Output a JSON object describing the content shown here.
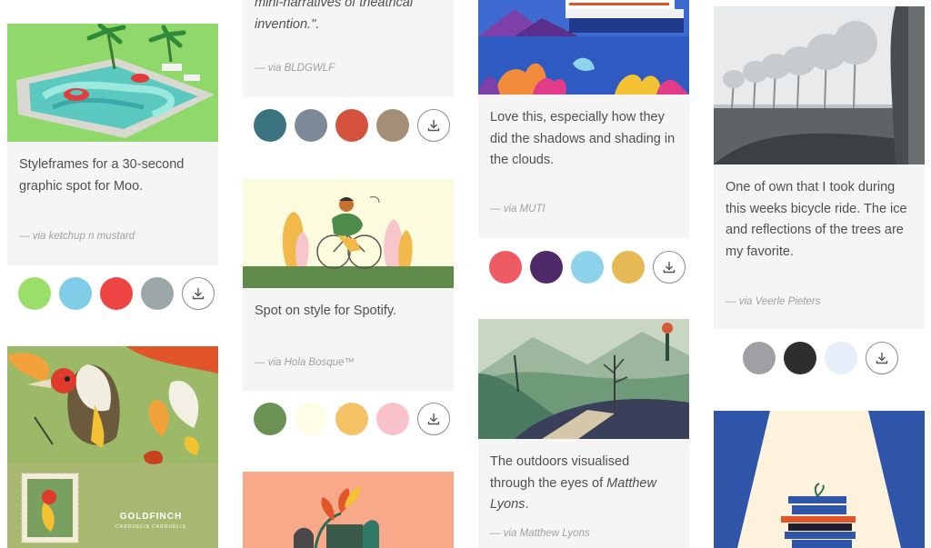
{
  "cards": [
    {
      "desc": "Styleframes for a 30-second graphic spot for Moo.",
      "via": "— via ketchup n mustard",
      "palette": [
        "#9bdf6b",
        "#7fcde6",
        "#ef4444",
        "#9ca7a8"
      ]
    },
    {
      "desc": "mini-narratives of theatrical invention.\".",
      "via": "— via BLDGWLF",
      "palette": [
        "#3b7280",
        "#7d8a99",
        "#d5533e",
        "#a58e78"
      ]
    },
    {
      "desc": "Spot on style for Spotify.",
      "via": "— via Hola Bosque™",
      "palette": [
        "#6b9153",
        "#fefde5",
        "#f6c266",
        "#f9c3cb"
      ]
    },
    {
      "desc": "Love this, especially how they did the shadows and shading in the clouds.",
      "via": "— via MUTI",
      "palette": [
        "#ef5b62",
        "#4e2a6b",
        "#8ed3ec",
        "#e7b955"
      ]
    },
    {
      "desc_prefix": "The outdoors visualised through the eyes of ",
      "desc_emph": "Matthew Lyons",
      "desc_suffix": ".",
      "via": "— via Matthew Lyons"
    },
    {
      "desc": "One of own that I took during this weeks bicycle ride. The ice and reflections of the trees are my favorite.",
      "via": "— via Veerle Pieters",
      "palette": [
        "#9ea0a4",
        "#2e2e2e",
        "#e6eef9"
      ]
    }
  ],
  "images": {
    "goldfinch_title": "GOLDFINCH",
    "goldfinch_subtitle": "CARDUELIS CARDUELIS"
  },
  "icons": {
    "download": "download-icon"
  }
}
